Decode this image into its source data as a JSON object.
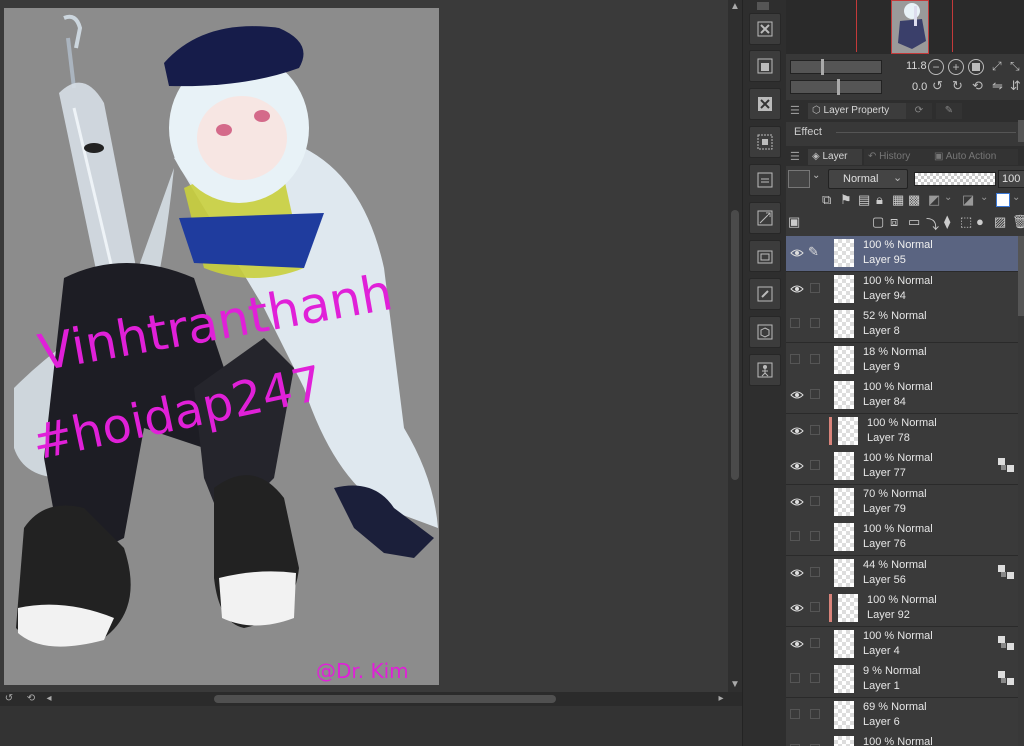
{
  "artwork": {
    "watermark_line1": "Vinhtranthanh",
    "watermark_line2": "#hoidap247",
    "signature": "@Dr. Kim"
  },
  "navigator": {
    "zoom_value": "11.8",
    "rotate_value": "0.0"
  },
  "panels": {
    "layer_property_tab": "Layer Property",
    "effect_label": "Effect",
    "layer_tab": "Layer",
    "history_tab": "History",
    "auto_action_tab": "Auto Action"
  },
  "layer_controls": {
    "blend_mode": "Normal",
    "opacity": "100"
  },
  "colors": {
    "selected_row": "#5a6481",
    "clip_indicator": "#d9837a",
    "watermark": "#e020d8",
    "nav_frame": "#c43a3a"
  },
  "layers": [
    {
      "opacity_mode": "100 % Normal",
      "name": "Layer 95",
      "visible": true,
      "selected": true,
      "clip": false,
      "mask": false,
      "pen": true
    },
    {
      "opacity_mode": "100 % Normal",
      "name": "Layer 94",
      "visible": true,
      "selected": false,
      "clip": false,
      "mask": false
    },
    {
      "opacity_mode": "52 % Normal",
      "name": "Layer 8",
      "visible": false,
      "selected": false,
      "clip": false,
      "mask": false
    },
    {
      "opacity_mode": "18 % Normal",
      "name": "Layer 9",
      "visible": false,
      "selected": false,
      "clip": false,
      "mask": false
    },
    {
      "opacity_mode": "100 % Normal",
      "name": "Layer 84",
      "visible": true,
      "selected": false,
      "clip": false,
      "mask": false
    },
    {
      "opacity_mode": "100 % Normal",
      "name": "Layer 78",
      "visible": true,
      "selected": false,
      "clip": true,
      "mask": false
    },
    {
      "opacity_mode": "100 % Normal",
      "name": "Layer 77",
      "visible": true,
      "selected": false,
      "clip": false,
      "mask": true
    },
    {
      "opacity_mode": "70 % Normal",
      "name": "Layer 79",
      "visible": true,
      "selected": false,
      "clip": false,
      "mask": false
    },
    {
      "opacity_mode": "100 % Normal",
      "name": "Layer 76",
      "visible": false,
      "selected": false,
      "clip": false,
      "mask": false
    },
    {
      "opacity_mode": "44 % Normal",
      "name": "Layer 56",
      "visible": true,
      "selected": false,
      "clip": false,
      "mask": true
    },
    {
      "opacity_mode": "100 % Normal",
      "name": "Layer 92",
      "visible": true,
      "selected": false,
      "clip": true,
      "mask": false
    },
    {
      "opacity_mode": "100 % Normal",
      "name": "Layer 4",
      "visible": true,
      "selected": false,
      "clip": false,
      "mask": true
    },
    {
      "opacity_mode": "9 % Normal",
      "name": "Layer 1",
      "visible": false,
      "selected": false,
      "clip": false,
      "mask": true
    },
    {
      "opacity_mode": "69 % Normal",
      "name": "Layer 6",
      "visible": false,
      "selected": false,
      "clip": false,
      "mask": false
    },
    {
      "opacity_mode": "100 % Normal",
      "name": "",
      "visible": false,
      "selected": false,
      "clip": false,
      "mask": false
    }
  ],
  "icons": {
    "tool_buttons": [
      "clear-layer-icon",
      "fill-layer-icon",
      "clear-outside-icon",
      "new-raster-layer-icon",
      "new-vector-layer-icon",
      "transform-icon",
      "new-folder-icon",
      "edit-icon",
      "3d-object-icon",
      "pose-figure-icon"
    ]
  }
}
